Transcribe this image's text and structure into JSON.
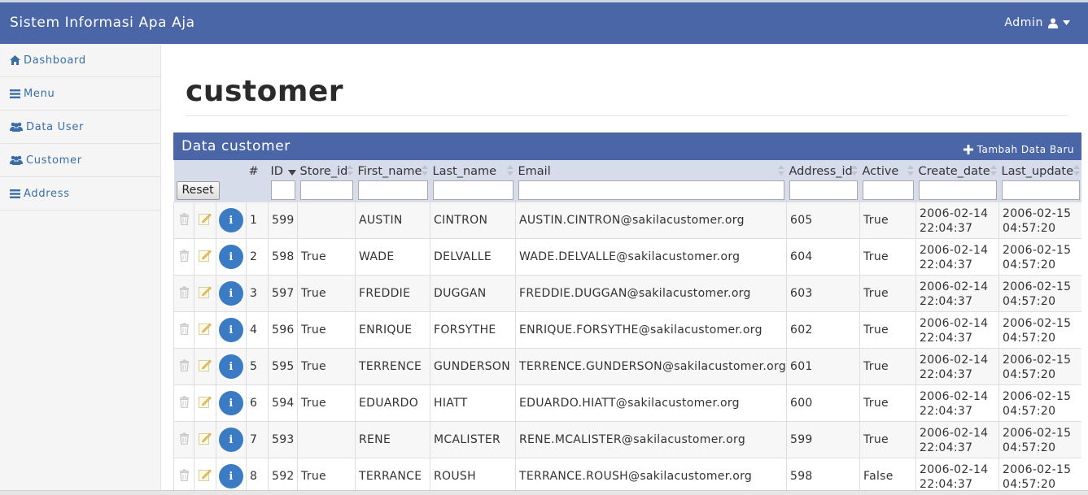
{
  "app": {
    "title": "Sistem Informasi Apa Aja",
    "user": "Admin"
  },
  "sidebar": {
    "items": [
      {
        "label": "Dashboard",
        "icon": "home-icon"
      },
      {
        "label": "Menu",
        "icon": "list-icon"
      },
      {
        "label": "Data User",
        "icon": "users-icon"
      },
      {
        "label": "Customer",
        "icon": "users-icon"
      },
      {
        "label": "Address",
        "icon": "list-icon"
      }
    ]
  },
  "page": {
    "title": "customer"
  },
  "panel": {
    "title": "Data customer",
    "add_label": "Tambah Data Baru",
    "reset_label": "Reset"
  },
  "table": {
    "columns": [
      "#",
      "ID",
      "Store_id",
      "First_name",
      "Last_name",
      "Email",
      "Address_id",
      "Active",
      "Create_date",
      "Last_update"
    ],
    "sorted_column": "ID",
    "sort_direction": "descending",
    "rows": [
      {
        "num": "1",
        "id": "599",
        "store_id": "",
        "first_name": "AUSTIN",
        "last_name": "CINTRON",
        "email": "AUSTIN.CINTRON@sakilacustomer.org",
        "address_id": "605",
        "active": "True",
        "create_date": "2006-02-14 22:04:37",
        "last_update": "2006-02-15 04:57:20"
      },
      {
        "num": "2",
        "id": "598",
        "store_id": "True",
        "first_name": "WADE",
        "last_name": "DELVALLE",
        "email": "WADE.DELVALLE@sakilacustomer.org",
        "address_id": "604",
        "active": "True",
        "create_date": "2006-02-14 22:04:37",
        "last_update": "2006-02-15 04:57:20"
      },
      {
        "num": "3",
        "id": "597",
        "store_id": "True",
        "first_name": "FREDDIE",
        "last_name": "DUGGAN",
        "email": "FREDDIE.DUGGAN@sakilacustomer.org",
        "address_id": "603",
        "active": "True",
        "create_date": "2006-02-14 22:04:37",
        "last_update": "2006-02-15 04:57:20"
      },
      {
        "num": "4",
        "id": "596",
        "store_id": "True",
        "first_name": "ENRIQUE",
        "last_name": "FORSYTHE",
        "email": "ENRIQUE.FORSYTHE@sakilacustomer.org",
        "address_id": "602",
        "active": "True",
        "create_date": "2006-02-14 22:04:37",
        "last_update": "2006-02-15 04:57:20"
      },
      {
        "num": "5",
        "id": "595",
        "store_id": "True",
        "first_name": "TERRENCE",
        "last_name": "GUNDERSON",
        "email": "TERRENCE.GUNDERSON@sakilacustomer.org",
        "address_id": "601",
        "active": "True",
        "create_date": "2006-02-14 22:04:37",
        "last_update": "2006-02-15 04:57:20"
      },
      {
        "num": "6",
        "id": "594",
        "store_id": "True",
        "first_name": "EDUARDO",
        "last_name": "HIATT",
        "email": "EDUARDO.HIATT@sakilacustomer.org",
        "address_id": "600",
        "active": "True",
        "create_date": "2006-02-14 22:04:37",
        "last_update": "2006-02-15 04:57:20"
      },
      {
        "num": "7",
        "id": "593",
        "store_id": "",
        "first_name": "RENE",
        "last_name": "MCALISTER",
        "email": "RENE.MCALISTER@sakilacustomer.org",
        "address_id": "599",
        "active": "True",
        "create_date": "2006-02-14 22:04:37",
        "last_update": "2006-02-15 04:57:20"
      },
      {
        "num": "8",
        "id": "592",
        "store_id": "True",
        "first_name": "TERRANCE",
        "last_name": "ROUSH",
        "email": "TERRANCE.ROUSH@sakilacustomer.org",
        "address_id": "598",
        "active": "False",
        "create_date": "2006-02-14 22:04:37",
        "last_update": "2006-02-15 04:57:20"
      }
    ]
  },
  "colors": {
    "header_bg": "#4a66a7",
    "table_header_bg": "#d6dcea",
    "link": "#3a6ea5",
    "info_button": "#3b7bc4"
  }
}
